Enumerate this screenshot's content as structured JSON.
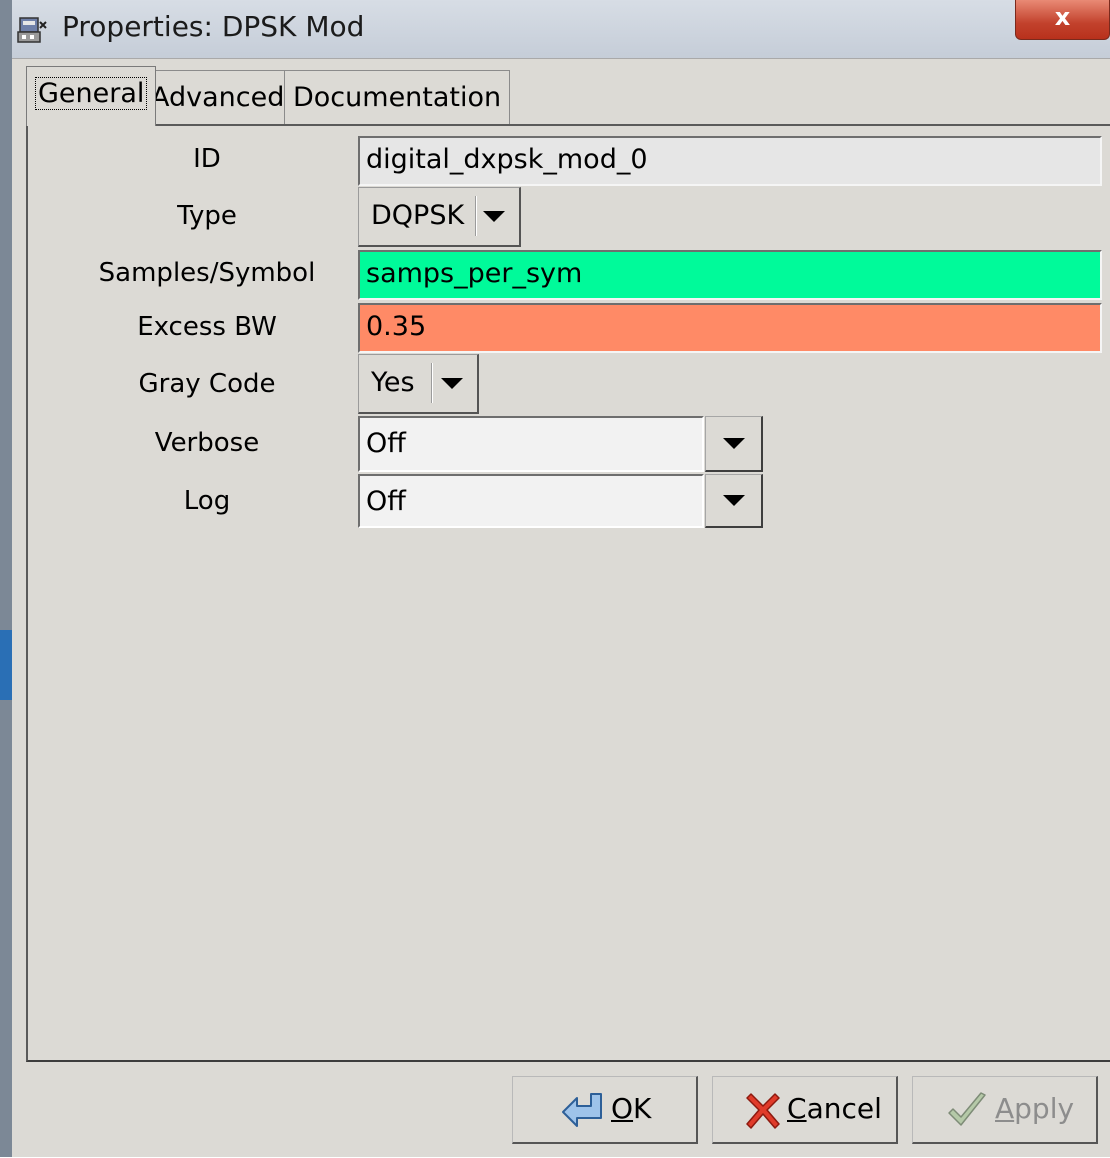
{
  "window": {
    "title": "Properties: DPSK Mod",
    "close_label": "x"
  },
  "tabs": [
    {
      "label": "General",
      "active": true
    },
    {
      "label": "Advanced",
      "active": false
    },
    {
      "label": "Documentation",
      "active": false
    }
  ],
  "fields": {
    "id": {
      "label": "ID",
      "value": "digital_dxpsk_mod_0"
    },
    "type": {
      "label": "Type",
      "value": "DQPSK"
    },
    "samples_per_symbol": {
      "label": "Samples/Symbol",
      "value": "samps_per_sym",
      "color": "#00fa9a"
    },
    "excess_bw": {
      "label": "Excess BW",
      "value": "0.35",
      "color": "#ff8a66"
    },
    "gray_code": {
      "label": "Gray Code",
      "value": "Yes"
    },
    "verbose": {
      "label": "Verbose",
      "value": "Off"
    },
    "log": {
      "label": "Log",
      "value": "Off"
    }
  },
  "buttons": {
    "ok": {
      "mnemonic": "O",
      "rest": "K",
      "icon": "back-arrow-icon"
    },
    "cancel": {
      "mnemonic": "C",
      "rest": "ancel",
      "icon": "red-x-icon"
    },
    "apply": {
      "mnemonic": "A",
      "rest": "pply",
      "icon": "checkmark-icon",
      "enabled": false
    }
  }
}
